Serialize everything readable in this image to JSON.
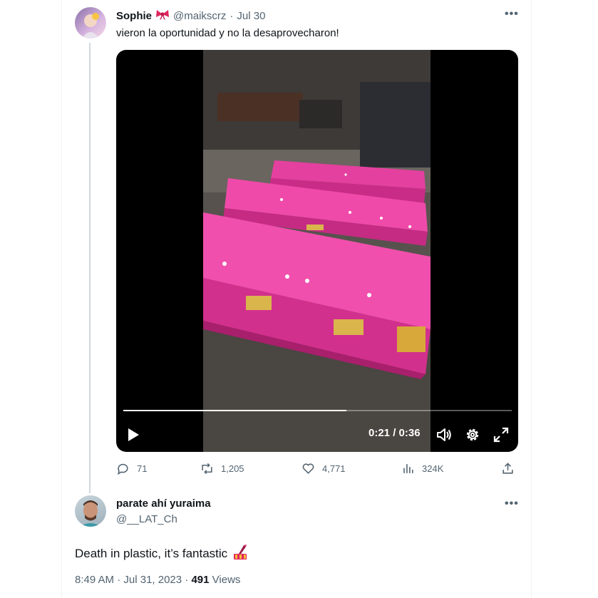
{
  "tweet": {
    "display_name": "Sophie",
    "handle": "@maikscrz",
    "separator": "·",
    "date": "Jul 30",
    "text": "vieron la oportunidad y no la desaprovecharon!",
    "more": "•••",
    "video": {
      "time": "0:21 / 0:36",
      "progress": 0.575
    },
    "actions": {
      "replies": "71",
      "reposts": "1,205",
      "likes": "4,771",
      "views": "324K"
    }
  },
  "reply": {
    "display_name": "parate ahí yuraima",
    "handle": "@__LAT_Ch",
    "more": "•••",
    "text": "Death in plastic, it’s fantastic",
    "time": "8:49 AM",
    "separator": "·",
    "date": "Jul 31, 2023",
    "dot": "·",
    "views_count": "491",
    "views_label": "Views"
  },
  "colors": {
    "text": "#0f1419",
    "muted": "#536471",
    "pink": "#e8339a"
  }
}
